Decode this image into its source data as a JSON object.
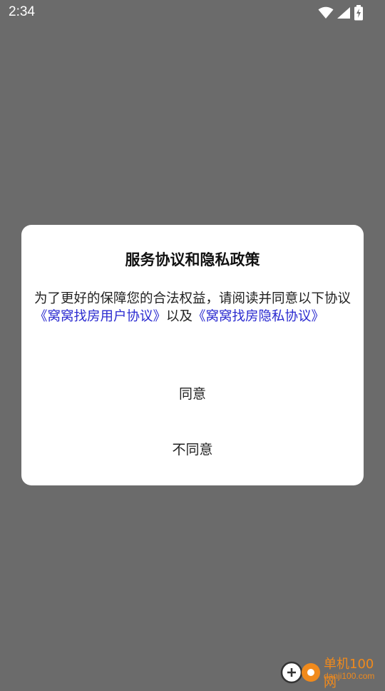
{
  "status_bar": {
    "time": "2:34"
  },
  "dialog": {
    "title": "服务协议和隐私政策",
    "body_text": "为了更好的保障您的合法权益，请阅读并同意以下协议",
    "user_agreement_link": "《窝窝找房用户协议》",
    "connector": "以及",
    "privacy_link": "《窝窝找房隐私协议》",
    "agree_label": "同意",
    "disagree_label": "不同意"
  },
  "watermark": {
    "name": "单机100网",
    "domain": "danji100.com"
  },
  "colors": {
    "overlay": "#6b6b6b",
    "link": "#2b2bd0",
    "watermark": "#f08a1c"
  }
}
